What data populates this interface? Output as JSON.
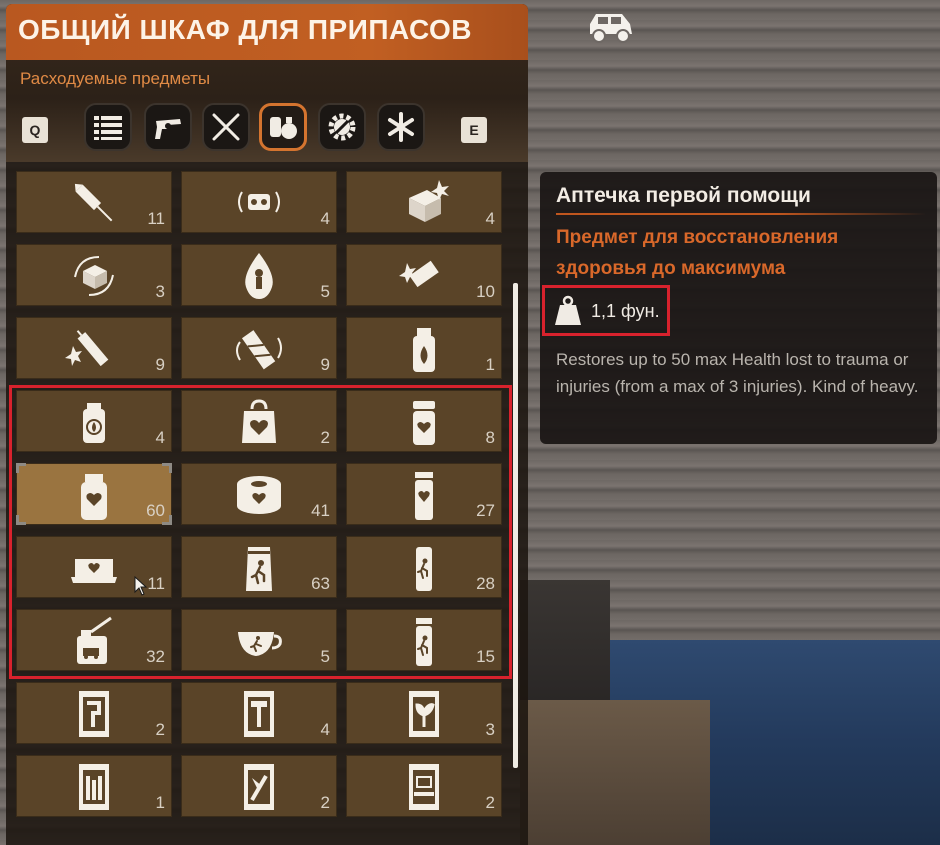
{
  "panel": {
    "title": "ОБЩИЙ ШКАФ ДЛЯ ПРИПАСОВ",
    "subtitle": "Расходуемые предметы",
    "prev_key": "Q",
    "next_key": "E",
    "active_tab": "consumables",
    "tabs": [
      {
        "id": "all",
        "icon": "list-icon"
      },
      {
        "id": "weapons",
        "icon": "revolver-icon"
      },
      {
        "id": "melee",
        "icon": "crossed-blades-icon"
      },
      {
        "id": "consumables",
        "icon": "consumables-icon"
      },
      {
        "id": "resources",
        "icon": "gear-wrench-icon"
      },
      {
        "id": "misc",
        "icon": "asterisk-icon"
      }
    ]
  },
  "grid": {
    "selected_index": 12,
    "items": [
      {
        "icon": "firework-rocket-icon",
        "count": "11"
      },
      {
        "icon": "noise-maker-icon",
        "count": "4"
      },
      {
        "icon": "explosive-crate-icon",
        "count": "4"
      },
      {
        "icon": "spinning-crate-icon",
        "count": "3"
      },
      {
        "icon": "plague-drop-icon",
        "count": "5"
      },
      {
        "icon": "exploding-bar-icon",
        "count": "10"
      },
      {
        "icon": "dynamite-stick-icon",
        "count": "9"
      },
      {
        "icon": "wrapped-stick-icon",
        "count": "9"
      },
      {
        "icon": "cure-bottle-icon",
        "count": "1"
      },
      {
        "icon": "small-cure-jar-icon",
        "count": "4"
      },
      {
        "icon": "heart-satchel-icon",
        "count": "2"
      },
      {
        "icon": "heart-pill-bottle-icon",
        "count": "8"
      },
      {
        "icon": "heart-jar-icon",
        "count": "60"
      },
      {
        "icon": "heart-bandage-roll-icon",
        "count": "41"
      },
      {
        "icon": "heart-canister-icon",
        "count": "27"
      },
      {
        "icon": "first-aid-kit-icon",
        "count": "11"
      },
      {
        "icon": "stamina-bag-icon",
        "count": "63"
      },
      {
        "icon": "stamina-can-icon",
        "count": "28"
      },
      {
        "icon": "fuel-can-icon",
        "count": "32"
      },
      {
        "icon": "coffee-cup-icon",
        "count": "5"
      },
      {
        "icon": "stamina-tube-icon",
        "count": "15"
      },
      {
        "icon": "book-plumbing-icon",
        "count": "2"
      },
      {
        "icon": "book-hammer-icon",
        "count": "4"
      },
      {
        "icon": "book-plant-icon",
        "count": "3"
      },
      {
        "icon": "book-shelf-icon",
        "count": "1"
      },
      {
        "icon": "book-tools-icon",
        "count": "2"
      },
      {
        "icon": "book-computer-icon",
        "count": "2"
      }
    ]
  },
  "tooltip": {
    "title": "Аптечка первой помощи",
    "subtitle": "Предмет для восстановления здоровья до максимума",
    "weight": "1,1 фун.",
    "weight_icon": "weight-icon",
    "description": "Restores up to 50 max Health lost to trauma or injuries (from a max of 3 injuries). Kind of heavy."
  },
  "hud": {
    "vehicle_icon": "vehicle-icon"
  },
  "colors": {
    "title_bar": "#c15f22",
    "accent_orange": "#d9682a",
    "cell_bg": "#5a4428",
    "cell_selected": "#9a7440",
    "highlight_red": "#d8222d"
  }
}
